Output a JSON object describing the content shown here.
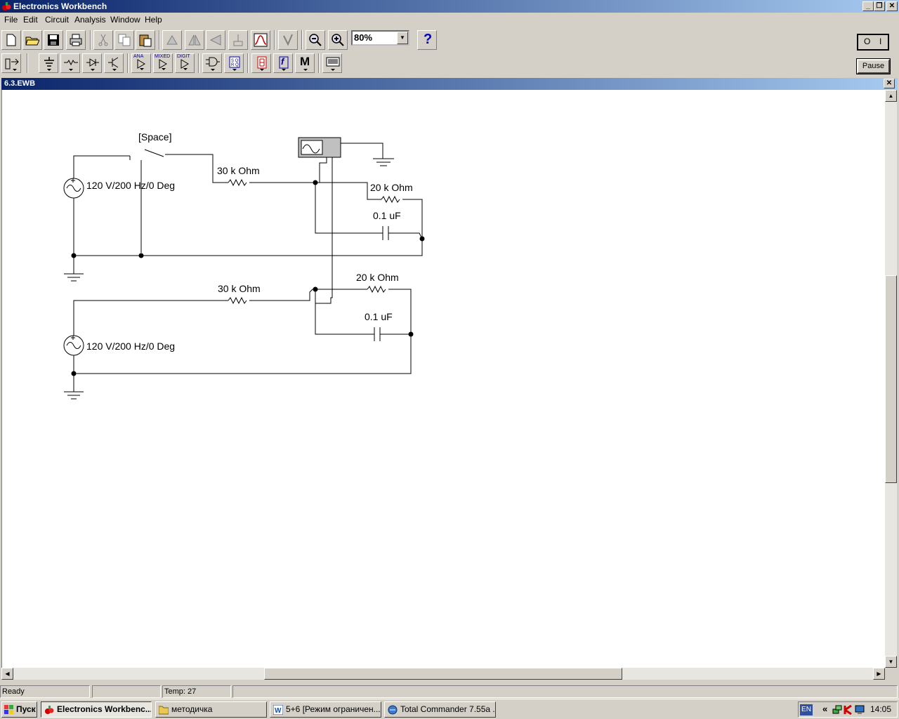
{
  "app": {
    "title": "Electronics Workbench"
  },
  "window_controls": {
    "minimize": "_",
    "restore": "❐",
    "close": "✕"
  },
  "menu": [
    "File",
    "Edit",
    "Circuit",
    "Analysis",
    "Window",
    "Help"
  ],
  "toolbar": {
    "zoom_value": "80%",
    "help_label": "?",
    "pause_label": "Pause",
    "power_off_label": "O",
    "power_on_label": "I"
  },
  "parts_bin": {
    "analog_label": "ANA",
    "mixed_label": "MIXED",
    "digital_label": "DIGIT",
    "misc_label": "M",
    "func_label": "f"
  },
  "document": {
    "title": "6.3.EWB",
    "close": "✕"
  },
  "circuit": {
    "switch_label": "[Space]",
    "source1_label": "120 V/200 Hz/0 Deg",
    "source2_label": "120 V/200 Hz/0 Deg",
    "r1_label": "30 k Ohm",
    "r2_label": "20 k Ohm",
    "c1_label": "0.1 uF",
    "r3_label": "30 k Ohm",
    "r4_label": "20 k Ohm",
    "c2_label": "0.1 uF"
  },
  "status": {
    "ready": "Ready",
    "blank": "",
    "temp": "Temp:  27"
  },
  "taskbar": {
    "start": "Пуск",
    "tasks": [
      "Electronics Workbenc...",
      "методичка",
      "5+6 [Режим ограничен...",
      "Total Commander 7.55a ..."
    ],
    "lang": "EN",
    "clock": "14:05",
    "tray_arrows": "«"
  },
  "colors": {
    "titlebar_start": "#0a246a",
    "titlebar_end": "#a6caf0",
    "face": "#d4d0c8"
  }
}
